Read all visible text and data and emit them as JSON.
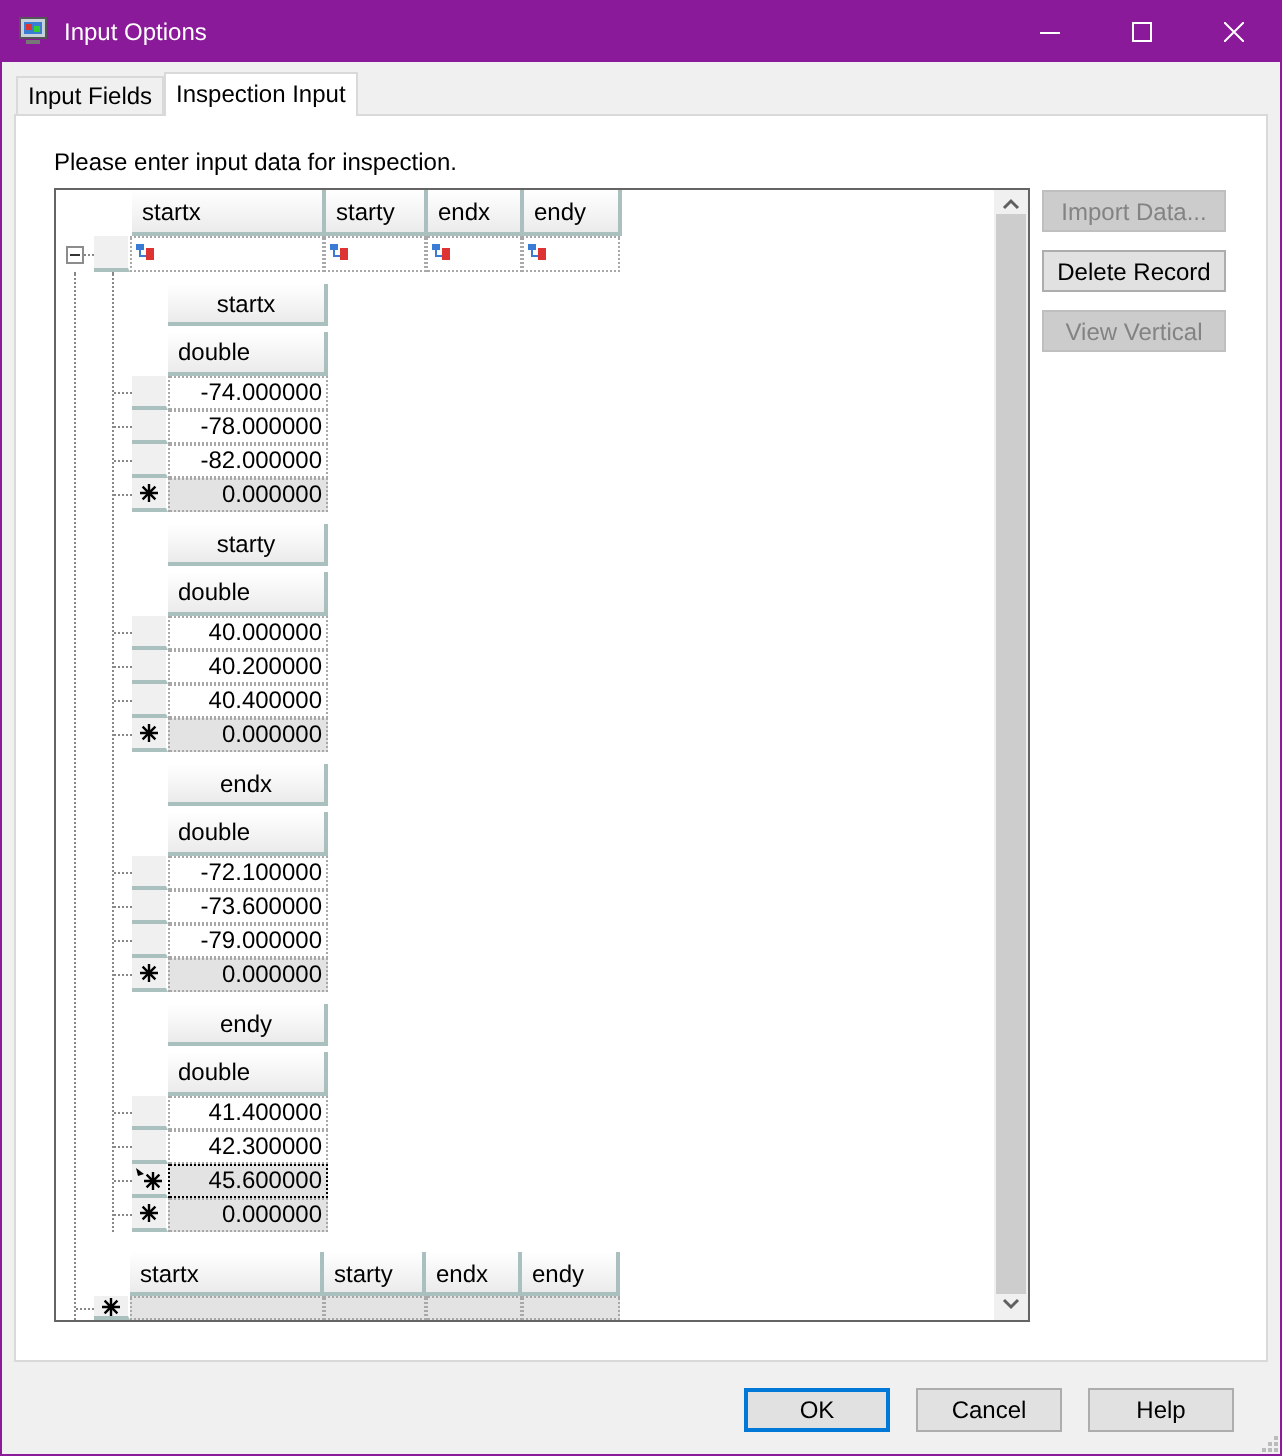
{
  "window": {
    "title": "Input Options"
  },
  "tabs": [
    {
      "label": "Input Fields",
      "selected": false
    },
    {
      "label": "Inspection Input",
      "selected": true
    }
  ],
  "instruction": "Please enter input data for inspection.",
  "grid": {
    "columns": [
      "startx",
      "starty",
      "endx",
      "endy"
    ],
    "parent_row": {
      "expanded": true
    },
    "child_tables": [
      {
        "header": "startx",
        "type": "double",
        "rows": [
          {
            "value": "-74.000000",
            "kind": "data"
          },
          {
            "value": "-78.000000",
            "kind": "data"
          },
          {
            "value": "-82.000000",
            "kind": "data"
          },
          {
            "value": "0.000000",
            "kind": "new"
          }
        ]
      },
      {
        "header": "starty",
        "type": "double",
        "rows": [
          {
            "value": "40.000000",
            "kind": "data"
          },
          {
            "value": "40.200000",
            "kind": "data"
          },
          {
            "value": "40.400000",
            "kind": "data"
          },
          {
            "value": "0.000000",
            "kind": "new"
          }
        ]
      },
      {
        "header": "endx",
        "type": "double",
        "rows": [
          {
            "value": "-72.100000",
            "kind": "data"
          },
          {
            "value": "-73.600000",
            "kind": "data"
          },
          {
            "value": "-79.000000",
            "kind": "data"
          },
          {
            "value": "0.000000",
            "kind": "new"
          }
        ]
      },
      {
        "header": "endy",
        "type": "double",
        "rows": [
          {
            "value": "41.400000",
            "kind": "data"
          },
          {
            "value": "42.300000",
            "kind": "data"
          },
          {
            "value": "45.600000",
            "kind": "current"
          },
          {
            "value": "0.000000",
            "kind": "new"
          }
        ]
      }
    ],
    "footer_columns": [
      "startx",
      "starty",
      "endx",
      "endy"
    ]
  },
  "side_buttons": [
    {
      "label": "Import Data...",
      "disabled": true
    },
    {
      "label": "Delete Record",
      "disabled": false
    },
    {
      "label": "View Vertical",
      "disabled": true
    }
  ],
  "buttons": [
    {
      "label": "OK",
      "default": true
    },
    {
      "label": "Cancel",
      "default": false
    },
    {
      "label": "Help",
      "default": false
    }
  ]
}
